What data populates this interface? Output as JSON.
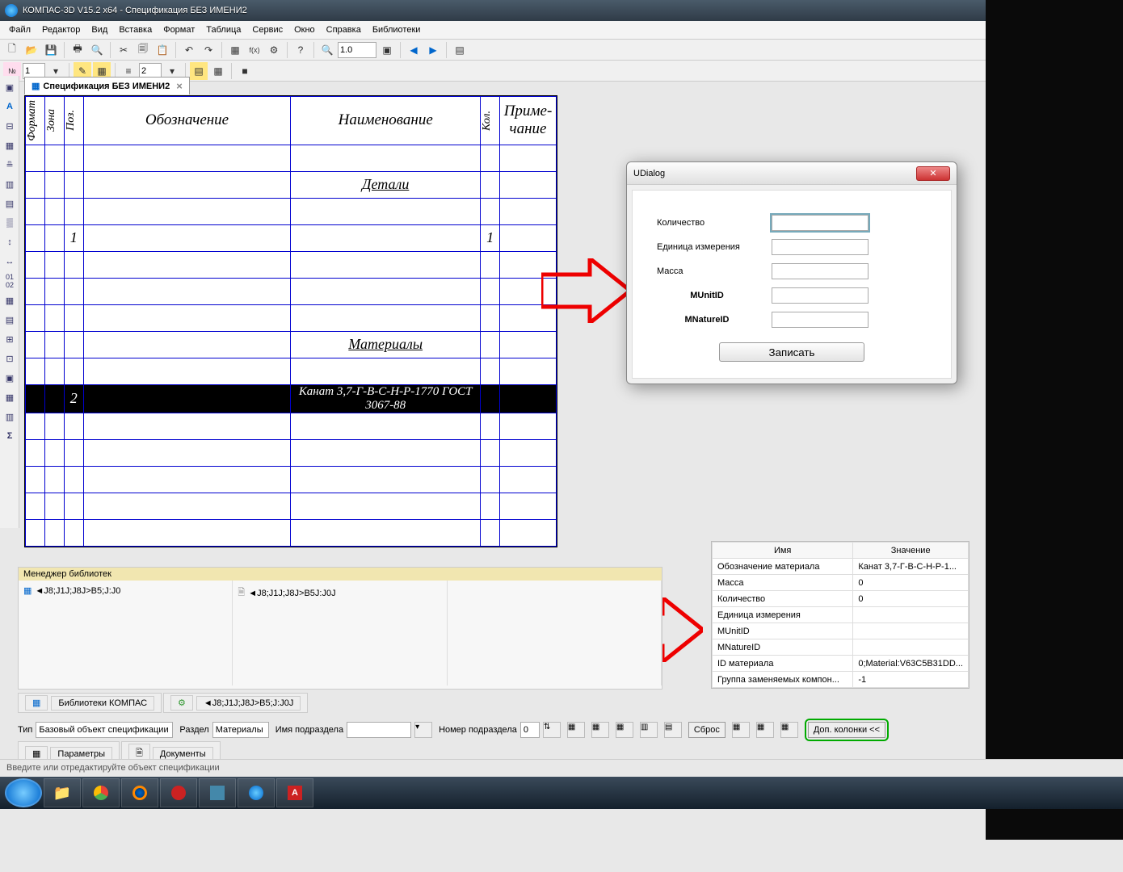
{
  "title": "КОМПАС-3D V15.2  x64 - Спецификация БЕЗ ИМЕНИ2",
  "menu": {
    "file": "Файл",
    "edit": "Редактор",
    "view": "Вид",
    "insert": "Вставка",
    "format": "Формат",
    "table": "Таблица",
    "service": "Сервис",
    "window": "Окно",
    "help": "Справка",
    "libs": "Библиотеки"
  },
  "toolbar_zoom": "1.0",
  "toolbar2_num": "1",
  "toolbar2_num2": "2",
  "doc_tab": "Спецификация БЕЗ ИМЕНИ2",
  "spec": {
    "headers": {
      "format": "Формат",
      "zone": "Зона",
      "pos": "Поз.",
      "designation": "Обозначение",
      "name": "Наименование",
      "qty": "Кол.",
      "note": "Приме-\nчание"
    },
    "section_details": "Детали",
    "section_materials": "Материалы",
    "row1": {
      "pos": "1",
      "qty": "1"
    },
    "row_sel": {
      "pos": "2",
      "name": "Канат 3,7-Г-В-С-Н-Р-1770 ГОСТ 3067-88"
    }
  },
  "udialog": {
    "title": "UDialog",
    "labels": {
      "qty": "Количество",
      "unit": "Единица измерения",
      "mass": "Масса",
      "muid": "MUnitID",
      "mnid": "MNatureID"
    },
    "save": "Записать"
  },
  "propgrid": {
    "headers": {
      "name": "Имя",
      "value": "Значение"
    },
    "rows": [
      {
        "n": "Обозначение материала",
        "v": "Канат 3,7-Г-В-С-Н-Р-1..."
      },
      {
        "n": "Масса",
        "v": "0"
      },
      {
        "n": "Количество",
        "v": "0"
      },
      {
        "n": "Единица измерения",
        "v": ""
      },
      {
        "n": "MUnitID",
        "v": ""
      },
      {
        "n": "MNatureID",
        "v": ""
      },
      {
        "n": "ID материала",
        "v": "0;Material:V63C5B31DD..."
      },
      {
        "n": "Группа заменяемых компон...",
        "v": "-1"
      }
    ]
  },
  "libpanel": {
    "title": "Менеджер библиотек",
    "file1": "◄J8;J1J;J8J>B5;J:J0",
    "file2": "◄J8;J1J;J8J>B5J:J0J"
  },
  "libtabs": {
    "t1": "Библиотеки КОМПАС",
    "t2": "◄J8;J1J;J8J>B5;J:J0J"
  },
  "bottombar": {
    "type_lbl": "Тип",
    "type_val": "Базовый объект спецификации",
    "section_lbl": "Раздел",
    "section_val": "Материалы",
    "subname_lbl": "Имя подраздела",
    "subname_val": "",
    "subnum_lbl": "Номер подраздела",
    "subnum_val": "0",
    "reset": "Сброс",
    "dopcol": "Доп. колонки  <<"
  },
  "bottomtabs": {
    "t1": "Параметры",
    "t2": "Документы"
  },
  "statusbar": "Введите или отредактируйте объект спецификации"
}
